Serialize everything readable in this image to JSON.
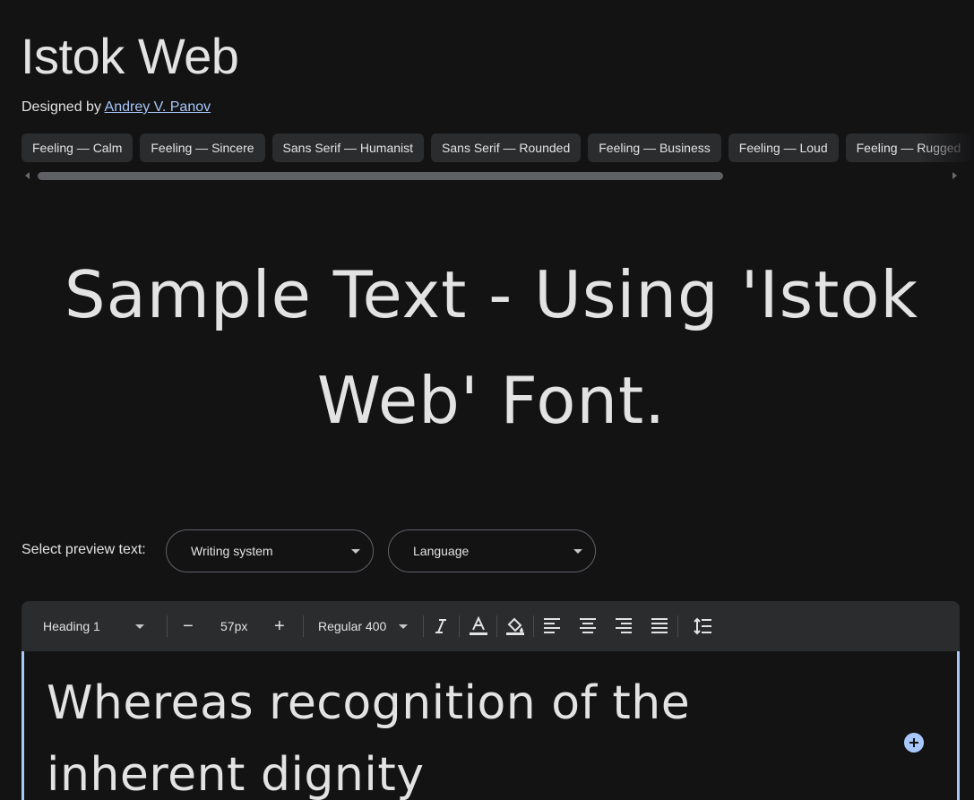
{
  "font": {
    "name": "Istok Web",
    "designed_by_label": "Designed by",
    "designer": "Andrey V. Panov"
  },
  "tags": [
    "Feeling — Calm",
    "Feeling — Sincere",
    "Sans Serif — Humanist",
    "Sans Serif — Rounded",
    "Feeling — Business",
    "Feeling — Loud",
    "Feeling — Rugged"
  ],
  "sample_text": "Sample Text - Using 'Istok Web' Font.",
  "preview": {
    "label": "Select preview text:",
    "writing_system": "Writing system",
    "language": "Language"
  },
  "toolbar": {
    "style": "Heading 1",
    "minus": "−",
    "size": "57px",
    "plus": "+",
    "weight": "Regular 400"
  },
  "editor": {
    "text": "Whereas recognition of the inherent dignity"
  },
  "colors": {
    "background": "#131314",
    "chip": "#2b2c2e",
    "accent": "#a8c7fa"
  }
}
